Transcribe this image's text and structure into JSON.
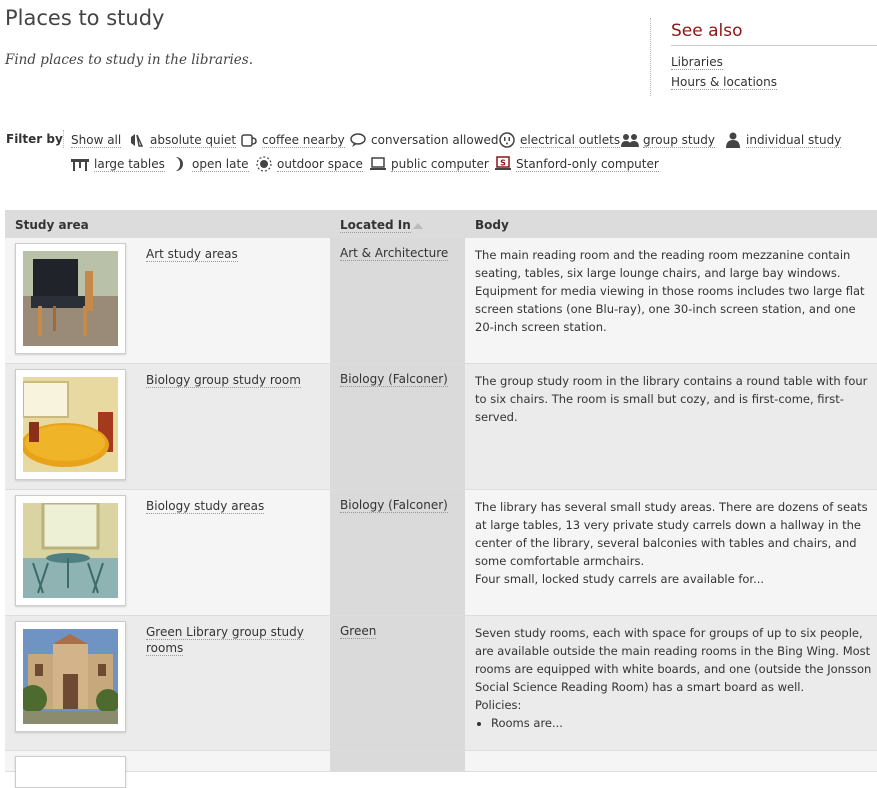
{
  "header": {
    "title": "Places to study",
    "subtitle": "Find places to study in the libraries."
  },
  "see_also": {
    "title": "See also",
    "links": [
      "Libraries",
      "Hours & locations"
    ]
  },
  "filters": {
    "label": "Filter by",
    "show_all": "Show all",
    "items": [
      {
        "label": "absolute quiet",
        "icon": "quiet-icon"
      },
      {
        "label": "coffee nearby",
        "icon": "coffee-cup-icon"
      },
      {
        "label": "conversation allowed",
        "icon": "speech-bubble-icon"
      },
      {
        "label": "electrical outlets",
        "icon": "outlet-icon"
      },
      {
        "label": "group study",
        "icon": "group-icon"
      },
      {
        "label": "individual study",
        "icon": "person-icon"
      },
      {
        "label": "large tables",
        "icon": "table-icon"
      },
      {
        "label": "open late",
        "icon": "moon-icon"
      },
      {
        "label": "outdoor space",
        "icon": "sun-icon"
      },
      {
        "label": "public computer",
        "icon": "computer-icon"
      },
      {
        "label": "Stanford-only computer",
        "icon": "stanford-computer-icon"
      }
    ]
  },
  "table": {
    "headers": {
      "area": "Study area",
      "located": "Located In",
      "body": "Body"
    },
    "rows": [
      {
        "area": "Art study areas",
        "location": "Art & Architecture",
        "body": "The main reading room and the reading room mezzanine contain seating, tables, six large lounge chairs, and large bay windows.  Equipment for media viewing in those rooms includes two large flat screen stations (one Blu-ray), one 30-inch screen station, and one 20-inch screen station."
      },
      {
        "area": "Biology group study room",
        "location": "Biology (Falconer)",
        "body": "The group study room in the library contains a round table with four to six chairs. The room is small but cozy, and is first-come, first-served."
      },
      {
        "area": "Biology study areas",
        "location": "Biology (Falconer)",
        "body": "The library has several small study areas. There are dozens of seats at large tables, 13 very private study carrels down a hallway in the center of the library, several balconies with tables and chairs, and some comfortable armchairs.",
        "body2": "Four small, locked study carrels are available for..."
      },
      {
        "area": "Green Library group study rooms",
        "location": "Green",
        "body": "Seven study rooms, each with space for groups of up to six people, are available outside the main reading rooms in the Bing Wing. Most rooms are equipped with white boards, and one (outside the Jonsson Social Science Reading Room) has a smart board as well.",
        "body2": "Policies:",
        "bullet": "Rooms are..."
      }
    ]
  }
}
